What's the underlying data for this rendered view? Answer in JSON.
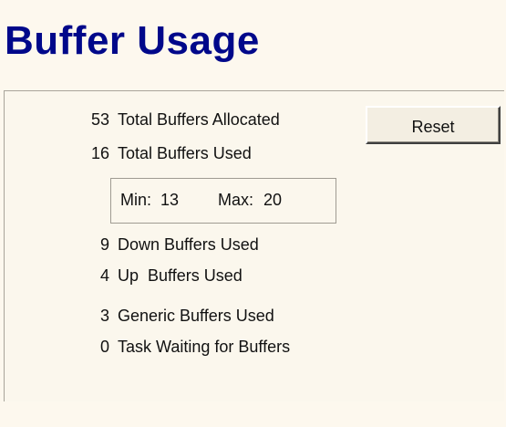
{
  "window": {
    "title": "Buffer Usage"
  },
  "stats": {
    "allocated": {
      "value": "53",
      "label": "Total Buffers Allocated"
    },
    "used": {
      "value": "16",
      "label": "Total Buffers Used"
    },
    "minmax": {
      "min_label": "Min:",
      "min_value": "13",
      "max_label": "Max:",
      "max_value": "20"
    },
    "down": {
      "value": "9",
      "label": "Down Buffers Used"
    },
    "up": {
      "value": "4",
      "label": "Up  Buffers Used"
    },
    "generic": {
      "value": "3",
      "label": "Generic Buffers Used"
    },
    "waiting": {
      "value": "0",
      "label": "Task Waiting for Buffers"
    }
  },
  "buttons": {
    "reset_label": "Reset"
  },
  "colors": {
    "title": "#00088a",
    "background": "#fdf8ee"
  }
}
